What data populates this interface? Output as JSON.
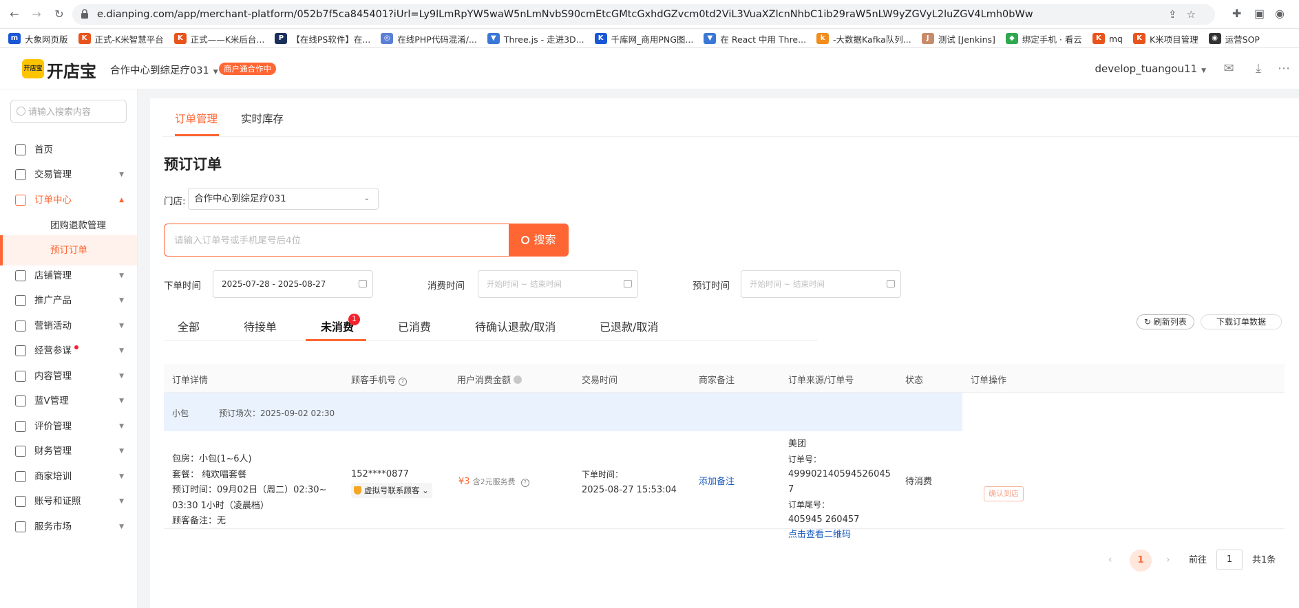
{
  "browser": {
    "url": "e.dianping.com/app/merchant-platform/052b7f5ca845401?iUrl=Ly9lLmRpYW5waW5nLmNvbS90cmEtcGMtcGxhdGZvcm0td2ViL3VuaXZlcnNhbC1ib29raW5nLW9yZGVyL2luZGV4Lmh0bWw",
    "bookmarks": [
      {
        "label": "大象网页版",
        "color": "#1a57d6",
        "icon": "m"
      },
      {
        "label": "正式-K米智慧平台",
        "color": "#e8541e",
        "icon": "K"
      },
      {
        "label": "正式——K米后台...",
        "color": "#e8541e",
        "icon": "K"
      },
      {
        "label": "【在线PS软件】在...",
        "color": "#1a2f5c",
        "icon": "P"
      },
      {
        "label": "在线PHP代码混淆/...",
        "color": "#5b7fd6",
        "icon": "◎"
      },
      {
        "label": "Three.js - 走进3D...",
        "color": "#3b77d6",
        "icon": "▼"
      },
      {
        "label": "千库网_商用PNG图...",
        "color": "#1a57d6",
        "icon": "K"
      },
      {
        "label": "在 React 中用 Thre...",
        "color": "#3b77d6",
        "icon": "▼"
      },
      {
        "label": "-大数据Kafka队列...",
        "color": "#f28c1c",
        "icon": "k"
      },
      {
        "label": "测试 [Jenkins]",
        "color": "#c98b6a",
        "icon": "J"
      },
      {
        "label": "绑定手机 · 看云",
        "color": "#2fa84f",
        "icon": "◆"
      },
      {
        "label": "mq",
        "color": "#e8541e",
        "icon": "K"
      },
      {
        "label": "K米项目管理",
        "color": "#e8541e",
        "icon": "K"
      },
      {
        "label": "运营SOP",
        "color": "#333333",
        "icon": "◉"
      }
    ]
  },
  "header": {
    "logo_mark": "开店宝",
    "logo_text": "开店宝",
    "store_name": "合作中心到综足疗031",
    "store_badge": "商户通合作中",
    "username": "develop_tuangou11"
  },
  "sidebar": {
    "search_placeholder": "请输入搜索内容",
    "items": [
      {
        "label": "首页",
        "caret": ""
      },
      {
        "label": "交易管理",
        "caret": "▼"
      },
      {
        "label": "订单中心",
        "caret": "▲"
      },
      {
        "label": "团购退款管理"
      },
      {
        "label": "预订订单"
      },
      {
        "label": "店铺管理",
        "caret": "▼"
      },
      {
        "label": "推广产品",
        "caret": "▼"
      },
      {
        "label": "营销活动",
        "caret": "▼"
      },
      {
        "label": "经营参谋",
        "caret": "▼"
      },
      {
        "label": "内容管理",
        "caret": "▼"
      },
      {
        "label": "蓝V管理",
        "caret": "▼"
      },
      {
        "label": "评价管理",
        "caret": "▼"
      },
      {
        "label": "财务管理",
        "caret": "▼"
      },
      {
        "label": "商家培训",
        "caret": "▼"
      },
      {
        "label": "账号和证照",
        "caret": "▼"
      },
      {
        "label": "服务市场",
        "caret": "▼"
      }
    ]
  },
  "main": {
    "tabs": [
      "订单管理",
      "实时库存"
    ],
    "page_title": "预订订单",
    "store_label": "门店:",
    "store_value": "合作中心到综足疗031",
    "search_placeholder": "请输入订单号或手机尾号后4位",
    "search_button": "搜索",
    "filters": {
      "order_time_label": "下单时间",
      "order_time_value": "2025-07-28 - 2025-08-27",
      "consume_time_label": "消费时间",
      "consume_time_placeholder": "开始时间 ~ 结束时间",
      "booking_time_label": "预订时间",
      "booking_time_placeholder": "开始时间 ~ 结束时间"
    },
    "status_tabs": [
      "全部",
      "待接单",
      "未消费",
      "已消费",
      "待确认退款/取消",
      "已退款/取消"
    ],
    "status_badge": "1",
    "refresh_button": "刷新列表",
    "download_button": "下载订单数据",
    "table": {
      "headers": [
        "订单详情",
        "顾客手机号",
        "用户消费金额",
        "交易时间",
        "商家备注",
        "订单来源/订单号",
        "状态",
        "订单操作"
      ],
      "group": {
        "room": "小包",
        "session": "预订场次：2025-09-02 02:30"
      },
      "row": {
        "detail": [
          "包房：小包(1~6人)",
          "套餐： 纯欢唱套餐",
          "预订时间：09月02日（周二）02:30~",
          "03:30 1小时（凌晨档）",
          "顾客备注：无"
        ],
        "phone": "152****0877",
        "phone_badge": "虚拟号联系顾客",
        "amount": "¥3",
        "amount_note": "含2元服务费",
        "time_label": "下单时间：",
        "time_value": "2025-08-27 15:53:04",
        "remark_link": "添加备注",
        "source": "美团",
        "order_no_label": "订单号：",
        "order_no_1": "499902140594526045",
        "order_no_2": "7",
        "tail_label": "订单尾号：",
        "tail_value": "405945 260457",
        "qr_link": "点击查看二维码",
        "status": "待消费",
        "action": "确认到店"
      }
    },
    "pagination": {
      "current": "1",
      "goto_label": "前往",
      "goto_value": "1",
      "total": "共1条"
    }
  }
}
